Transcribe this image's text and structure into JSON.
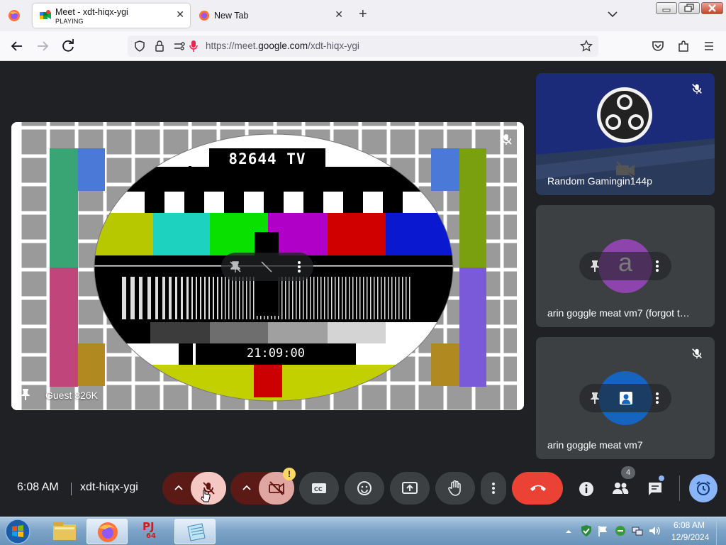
{
  "browser": {
    "tabs": [
      {
        "title": "Meet - xdt-hiqx-ygi",
        "subtitle": "PLAYING",
        "active": true
      },
      {
        "title": "New Tab",
        "active": false
      }
    ],
    "url_prefix": "https://meet.",
    "url_domain": "google.com",
    "url_path": "/xdt-hiqx-ygi",
    "new_tab_symbol": "+",
    "close_symbol": "✕"
  },
  "meet": {
    "main_tile": {
      "participant": "Guest 826K",
      "card_title": "82644 TV",
      "card_clock": "21:09:00",
      "muted": true
    },
    "side_tiles": [
      {
        "name": "Random Gamingin144p",
        "muted": true,
        "avatar": "obs-logo"
      },
      {
        "name": "arin goggle meat vm7 (forgot t…",
        "avatar_letter": "a",
        "avatar_color": "#8e44ad"
      },
      {
        "name": "arin goggle meat vm7",
        "muted": true,
        "avatar": "presenter-avatar",
        "avatar_color": "#1a73e8"
      }
    ],
    "bottom_bar": {
      "time": "6:08 AM",
      "meeting_code": "xdt-hiqx-ygi",
      "people_count": "4",
      "camera_warning": "!"
    }
  },
  "taskbar": {
    "clock_time": "6:08 AM",
    "clock_date": "12/9/2024",
    "pj_label": "PJ",
    "pj_sub": "64"
  },
  "colors": {
    "meet_bg": "#202124",
    "tile_bg": "#3c4043",
    "mic_off_red": "#f28b82",
    "end_call_red": "#ea4335",
    "camera_off_red": "#8c1d18",
    "accent_blue": "#8ab4f8"
  }
}
